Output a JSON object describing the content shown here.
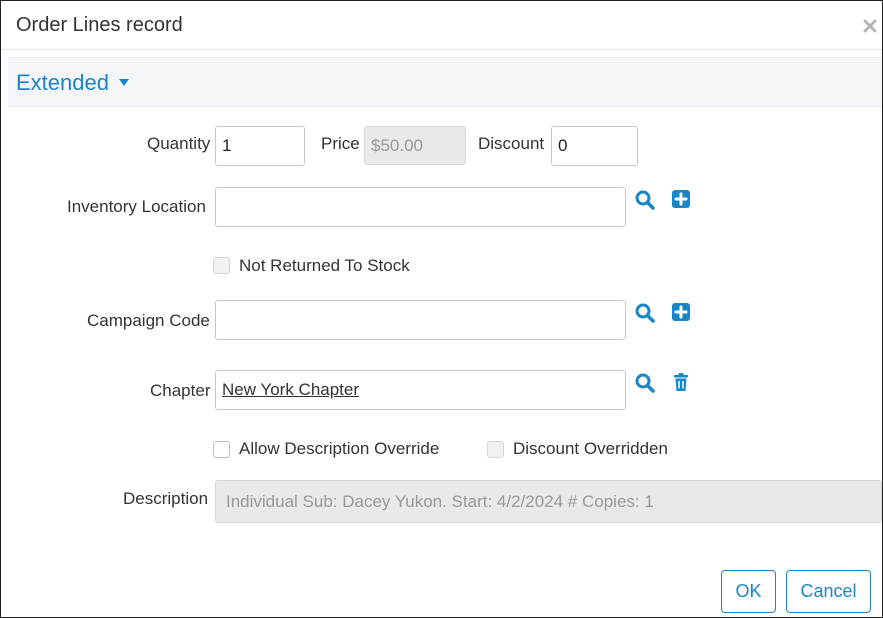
{
  "dialog": {
    "title": "Order Lines record"
  },
  "section": {
    "title": "Extended"
  },
  "fields": {
    "quantity": {
      "label": "Quantity",
      "value": "1"
    },
    "price": {
      "label": "Price",
      "value": "$50.00"
    },
    "discount": {
      "label": "Discount",
      "value": "0"
    },
    "inventory_location": {
      "label": "Inventory Location",
      "value": ""
    },
    "not_returned_to_stock": {
      "label": "Not Returned To Stock",
      "checked": false
    },
    "campaign_code": {
      "label": "Campaign Code",
      "value": ""
    },
    "chapter": {
      "label": "Chapter",
      "value": "New York Chapter"
    },
    "allow_description_override": {
      "label": "Allow Description Override",
      "checked": false
    },
    "discount_overridden": {
      "label": "Discount Overridden",
      "checked": false
    },
    "description": {
      "label": "Description",
      "value": "Individual Sub: Dacey Yukon. Start: 4/2/2024 # Copies: 1"
    }
  },
  "buttons": {
    "ok": "OK",
    "cancel": "Cancel"
  },
  "colors": {
    "accent": "#1a86c8",
    "section_bg": "#f4f6f9",
    "disabled_bg": "#e9e9e9"
  },
  "icons": {
    "close": "close-icon",
    "search": "search-icon",
    "add": "plus-square-icon",
    "delete": "trash-icon",
    "caret": "caret-down-icon"
  }
}
